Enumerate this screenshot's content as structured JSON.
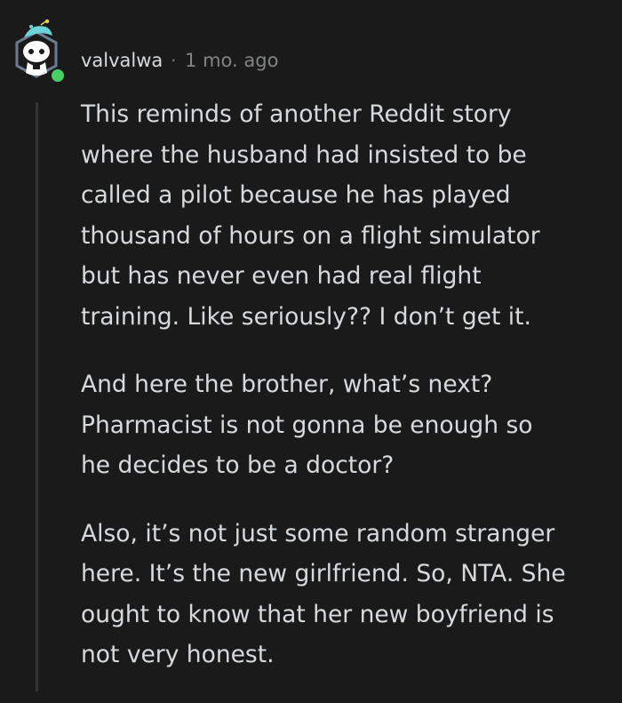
{
  "comment": {
    "username": "valvalwa",
    "separator": "·",
    "time": "1 mo. ago",
    "avatar_icon": "snoo-avatar-icon",
    "online_color": "#46d160",
    "paragraphs": [
      {
        "lines": [
          "This reminds of another Reddit story",
          "where the husband had insisted to be",
          "called a pilot because he has played",
          "thousand of hours on a flight simulator",
          "but has never even had real flight",
          "training. Like seriously?? I don’t get it."
        ]
      },
      {
        "lines": [
          "And here the brother, what’s next?",
          "Pharmacist is not gonna be enough so",
          "he decides to be a doctor?"
        ]
      },
      {
        "lines": [
          "Also, it’s not just some random stranger",
          "here. It’s the new girlfriend. So, NTA. She",
          "ought to know that her new boyfriend is",
          "not very honest."
        ]
      }
    ]
  }
}
